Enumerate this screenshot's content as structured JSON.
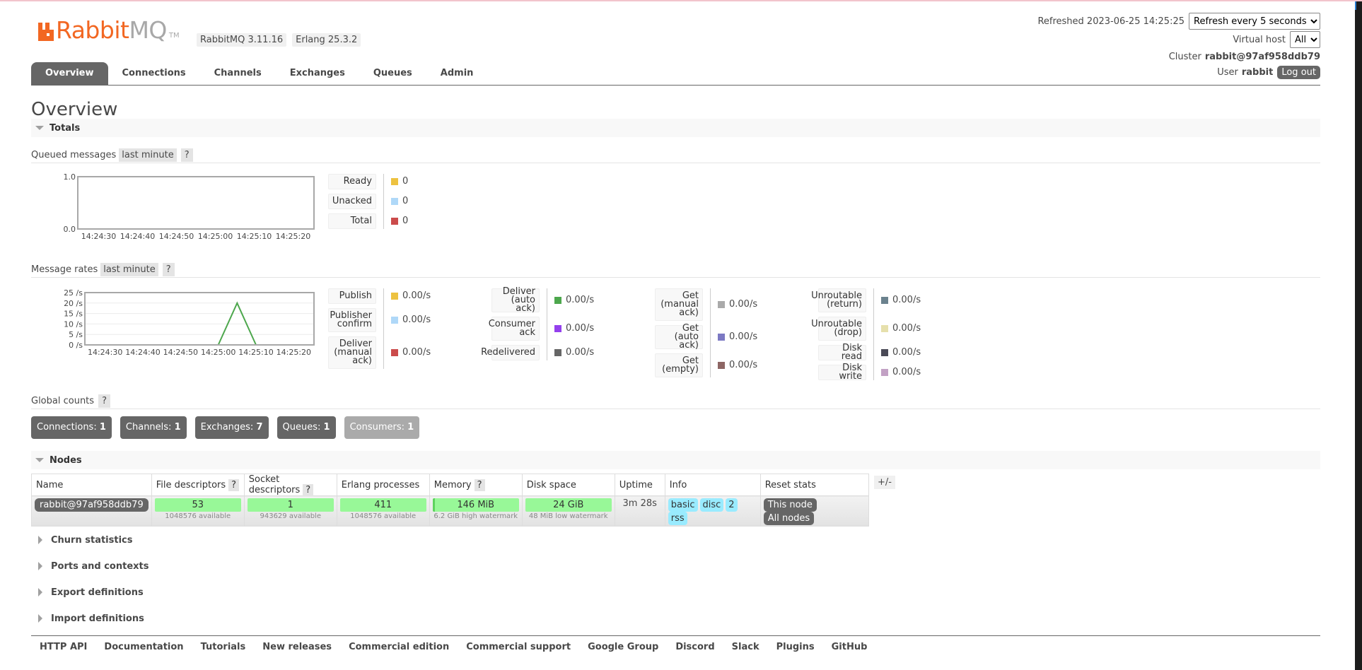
{
  "header": {
    "logo_text_orange": "Rabbit",
    "logo_text_gray": "MQ",
    "logo_tm": "TM",
    "rabbitmq_version": "RabbitMQ 3.11.16",
    "erlang_version": "Erlang 25.3.2",
    "refreshed_label": "Refreshed 2023-06-25 14:25:25",
    "refresh_select": "Refresh every 5 seconds",
    "vhost_label": "Virtual host",
    "vhost_select": "All",
    "cluster_label": "Cluster",
    "cluster_name": "rabbit@97af958ddb79",
    "user_label": "User",
    "user_name": "rabbit",
    "logout_label": "Log out"
  },
  "tabs": [
    {
      "label": "Overview",
      "active": true
    },
    {
      "label": "Connections"
    },
    {
      "label": "Channels"
    },
    {
      "label": "Exchanges"
    },
    {
      "label": "Queues"
    },
    {
      "label": "Admin"
    }
  ],
  "page_title": "Overview",
  "totals": {
    "title": "Totals",
    "queued": {
      "label": "Queued messages",
      "range": "last minute",
      "help": "?",
      "legend": [
        {
          "label": "Ready",
          "value": "0",
          "color": "#edc240"
        },
        {
          "label": "Unacked",
          "value": "0",
          "color": "#afd8f8"
        },
        {
          "label": "Total",
          "value": "0",
          "color": "#cb4b4b"
        }
      ]
    },
    "rates": {
      "label": "Message rates",
      "range": "last minute",
      "help": "?",
      "groups": [
        [
          {
            "label": "Publish",
            "value": "0.00/s",
            "color": "#edc240"
          },
          {
            "label": "Publisher confirm",
            "value": "0.00/s",
            "color": "#afd8f8"
          },
          {
            "label": "Deliver (manual ack)",
            "value": "0.00/s",
            "color": "#cb4b4b"
          }
        ],
        [
          {
            "label": "Deliver (auto ack)",
            "value": "0.00/s",
            "color": "#4da74d"
          },
          {
            "label": "Consumer ack",
            "value": "0.00/s",
            "color": "#9440ed"
          },
          {
            "label": "Redelivered",
            "value": "0.00/s",
            "color": "#666666"
          }
        ],
        [
          {
            "label": "Get (manual ack)",
            "value": "0.00/s",
            "color": "#aaaaaa"
          },
          {
            "label": "Get (auto ack)",
            "value": "0.00/s",
            "color": "#7c79c3"
          },
          {
            "label": "Get (empty)",
            "value": "0.00/s",
            "color": "#8d6664"
          }
        ],
        [
          {
            "label": "Unroutable (return)",
            "value": "0.00/s",
            "color": "#6b828e"
          },
          {
            "label": "Unroutable (drop)",
            "value": "0.00/s",
            "color": "#e6e0ac"
          },
          {
            "label": "Disk read",
            "value": "0.00/s",
            "color": "#4a4a57"
          },
          {
            "label": "Disk write",
            "value": "0.00/s",
            "color": "#c2a1c4"
          }
        ]
      ]
    },
    "global_counts": {
      "label": "Global counts",
      "help": "?",
      "items": [
        {
          "label": "Connections:",
          "value": "1"
        },
        {
          "label": "Channels:",
          "value": "1"
        },
        {
          "label": "Exchanges:",
          "value": "7"
        },
        {
          "label": "Queues:",
          "value": "1"
        },
        {
          "label": "Consumers:",
          "value": "1",
          "dim": true
        }
      ]
    }
  },
  "chart_data": [
    {
      "type": "line",
      "title": "Queued messages",
      "x": [
        "14:24:25",
        "14:24:30",
        "14:24:35",
        "14:24:40",
        "14:24:45",
        "14:24:50",
        "14:24:55",
        "14:25:00",
        "14:25:05",
        "14:25:10",
        "14:25:15",
        "14:25:20",
        "14:25:25"
      ],
      "xticks": [
        "14:24:30",
        "14:24:40",
        "14:24:50",
        "14:25:00",
        "14:25:10",
        "14:25:20"
      ],
      "yticks": [
        "0.0",
        "1.0"
      ],
      "ylim": [
        0,
        1
      ],
      "series": [
        {
          "name": "Ready",
          "color": "#edc240",
          "values": [
            0,
            0,
            0,
            0,
            0,
            0,
            0,
            0,
            0,
            0,
            0,
            0,
            0
          ]
        },
        {
          "name": "Unacked",
          "color": "#afd8f8",
          "values": [
            0,
            0,
            0,
            0,
            0,
            0,
            0,
            0,
            0,
            0,
            0,
            0,
            0
          ]
        },
        {
          "name": "Total",
          "color": "#cb4b4b",
          "values": [
            0,
            0,
            0,
            0,
            0,
            0,
            0,
            0,
            0,
            0,
            0,
            0,
            0
          ]
        }
      ]
    },
    {
      "type": "line",
      "title": "Message rates",
      "x": [
        "14:24:25",
        "14:24:30",
        "14:24:35",
        "14:24:40",
        "14:24:45",
        "14:24:50",
        "14:24:55",
        "14:25:00",
        "14:25:05",
        "14:25:10",
        "14:25:15",
        "14:25:20",
        "14:25:25"
      ],
      "xticks": [
        "14:24:30",
        "14:24:40",
        "14:24:50",
        "14:25:00",
        "14:25:10",
        "14:25:20"
      ],
      "yticks": [
        "0 /s",
        "5 /s",
        "10 /s",
        "15 /s",
        "20 /s",
        "25 /s"
      ],
      "ylim": [
        0,
        25
      ],
      "grid": true,
      "series": [
        {
          "name": "Deliver (auto ack)",
          "color": "#4da74d",
          "values": [
            0,
            0,
            0,
            0,
            0,
            0,
            0,
            0,
            20,
            0,
            0,
            0,
            0
          ]
        },
        {
          "name": "Disk write",
          "color": "#c2a1c4",
          "values": [
            0,
            0,
            0,
            0,
            0,
            0,
            0,
            0,
            0,
            0,
            0,
            0,
            0
          ]
        }
      ]
    }
  ],
  "nodes": {
    "title": "Nodes",
    "columns": [
      "Name",
      "File descriptors",
      "Socket descriptors",
      "Erlang processes",
      "Memory",
      "Disk space",
      "Uptime",
      "Info",
      "Reset stats"
    ],
    "help_columns": [
      "File descriptors",
      "Socket descriptors",
      "Memory"
    ],
    "help": "?",
    "rows": [
      {
        "name": "rabbit@97af958ddb79",
        "fd": "53",
        "fd_sub": "1048576 available",
        "sockets": "1",
        "sockets_sub": "943629 available",
        "procs": "411",
        "procs_sub": "1048576 available",
        "memory": "146 MiB",
        "memory_sub": "6.2 GiB high watermark",
        "memory_fraction": 0.023,
        "disk": "24 GiB",
        "disk_sub": "48 MiB low watermark",
        "uptime": "3m 28s",
        "info": [
          "basic",
          "disc",
          "2",
          "rss"
        ],
        "reset": [
          "This node",
          "All nodes"
        ]
      }
    ],
    "plusminus": "+/-"
  },
  "collapsed_sections": [
    "Churn statistics",
    "Ports and contexts",
    "Export definitions",
    "Import definitions"
  ],
  "footer": [
    "HTTP API",
    "Documentation",
    "Tutorials",
    "New releases",
    "Commercial edition",
    "Commercial support",
    "Google Group",
    "Discord",
    "Slack",
    "Plugins",
    "GitHub"
  ]
}
